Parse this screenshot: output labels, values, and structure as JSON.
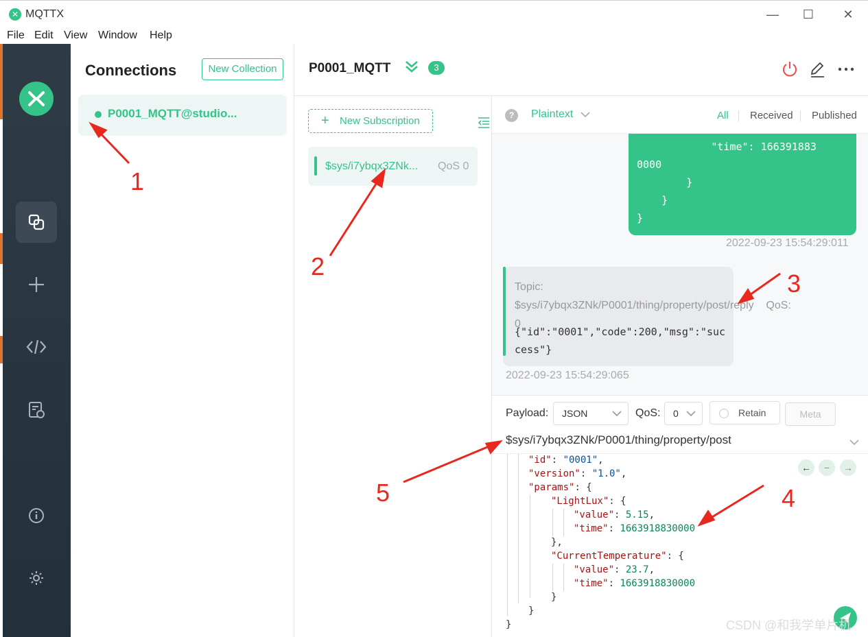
{
  "window": {
    "title": "MQTTX",
    "minimize": "—",
    "maximize": "☐",
    "close": "✕"
  },
  "menu": [
    "File",
    "Edit",
    "View",
    "Window",
    "Help"
  ],
  "connections": {
    "title": "Connections",
    "new_collection": "New Collection",
    "items": [
      {
        "name": "P0001_MQTT@studio...",
        "status": "connected"
      }
    ]
  },
  "header": {
    "title": "P0001_MQTT",
    "badge": "3"
  },
  "subscriptions": {
    "new_label": "New Subscription",
    "items": [
      {
        "topic": "$sys/i7ybqx3ZNk...",
        "qos": "QoS 0"
      }
    ]
  },
  "messages": {
    "format": "Plaintext",
    "tabs": [
      "All",
      "Received",
      "Published"
    ],
    "active_tab": "All",
    "outgoing": {
      "lines": [
        "            \"time\": 166391883",
        "0000",
        "        }",
        "    }",
        "}"
      ],
      "timestamp": "2022-09-23 15:54:29:011"
    },
    "incoming": {
      "topic": "Topic: $sys/i7ybqx3ZNk/P0001/thing/property/post/reply",
      "qos": "QoS: 0",
      "payload": "{\"id\":\"0001\",\"code\":200,\"msg\":\"success\"}",
      "timestamp": "2022-09-23 15:54:29:065"
    }
  },
  "publish": {
    "payload_label": "Payload:",
    "payload_format": "JSON",
    "qos_label": "QoS:",
    "qos_value": "0",
    "retain_label": "Retain",
    "meta_label": "Meta",
    "topic": "$sys/i7ybqx3ZNk/P0001/thing/property/post",
    "code": {
      "id_key": "\"id\"",
      "id_val": "\"0001\"",
      "version_key": "\"version\"",
      "version_val": "\"1.0\"",
      "params_key": "\"params\"",
      "light_key": "\"LightLux\"",
      "value_key": "\"value\"",
      "light_value": "5.15",
      "time_key": "\"time\"",
      "time_val": "1663918830000",
      "temp_key": "\"CurrentTemperature\"",
      "temp_value": "23.7"
    }
  },
  "annotations": [
    "1",
    "2",
    "3",
    "4",
    "5"
  ],
  "watermark": "CSDN @和我学单片机",
  "colors": {
    "accent": "#34c388",
    "sidebar": "#2a3640",
    "arrow": "#e8271f"
  }
}
